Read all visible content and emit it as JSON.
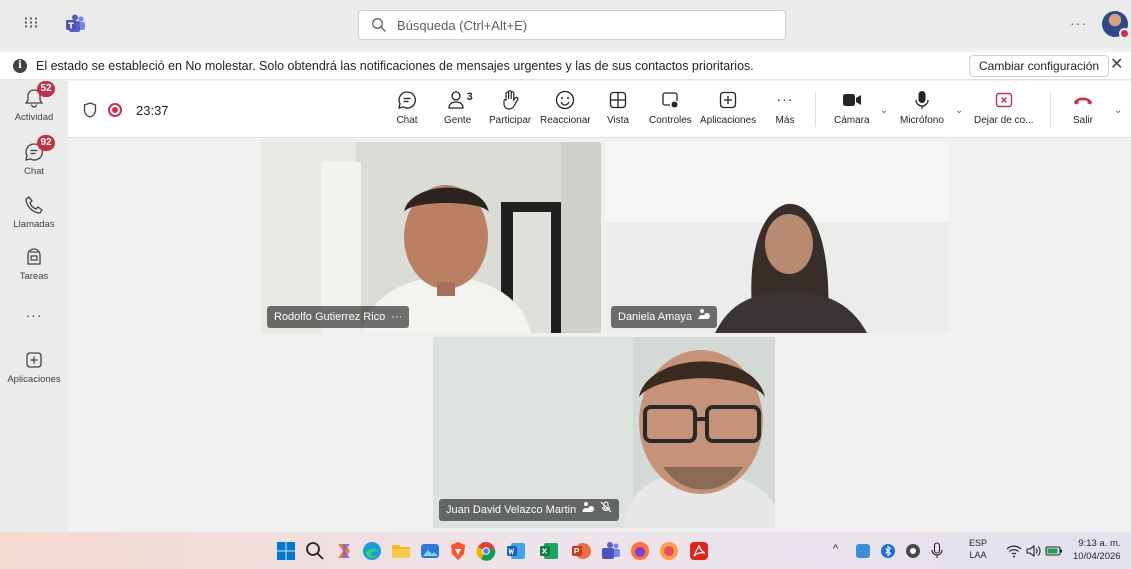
{
  "titlebar": {
    "search_placeholder": "Búsqueda (Ctrl+Alt+E)",
    "more_label": "···"
  },
  "notice": {
    "message": "El estado se estableció en No molestar. Solo obtendrá las notificaciones de mensajes urgentes y las de sus contactos prioritarios.",
    "change_settings": "Cambiar configuración",
    "close": "✕"
  },
  "rail": {
    "items": [
      {
        "label": "Actividad",
        "badge": "52",
        "icon": "bell-icon"
      },
      {
        "label": "Chat",
        "badge": "92",
        "icon": "chat-icon"
      },
      {
        "label": "Llamadas",
        "badge": "",
        "icon": "phone-icon"
      },
      {
        "label": "Tareas",
        "badge": "",
        "icon": "tasks-icon"
      }
    ],
    "more": "···",
    "apps_label": "Aplicaciones"
  },
  "meeting": {
    "timer": "23:37",
    "people_count": "3",
    "buttons": {
      "chat": "Chat",
      "people": "Gente",
      "raise": "Participar",
      "react": "Reaccionar",
      "view": "Vista",
      "controls": "Controles",
      "apps": "Aplicaciones",
      "more": "Más",
      "camera": "Cámara",
      "mic": "Micrófono",
      "stop_share": "Dejar de co...",
      "leave": "Salir"
    }
  },
  "participants": [
    {
      "name": "Rodolfo Gutierrez Rico"
    },
    {
      "name": "Daniela Amaya"
    },
    {
      "name": "Juan David Velazco Martin"
    }
  ],
  "taskbar": {
    "lang_top": "ESP",
    "lang_bottom": "LAA",
    "time": "9:13 a. m.",
    "date": "10/04/2026"
  },
  "colors": {
    "accent": "#5b5fc7",
    "badge": "#c4314b",
    "leave": "#c4314b"
  }
}
